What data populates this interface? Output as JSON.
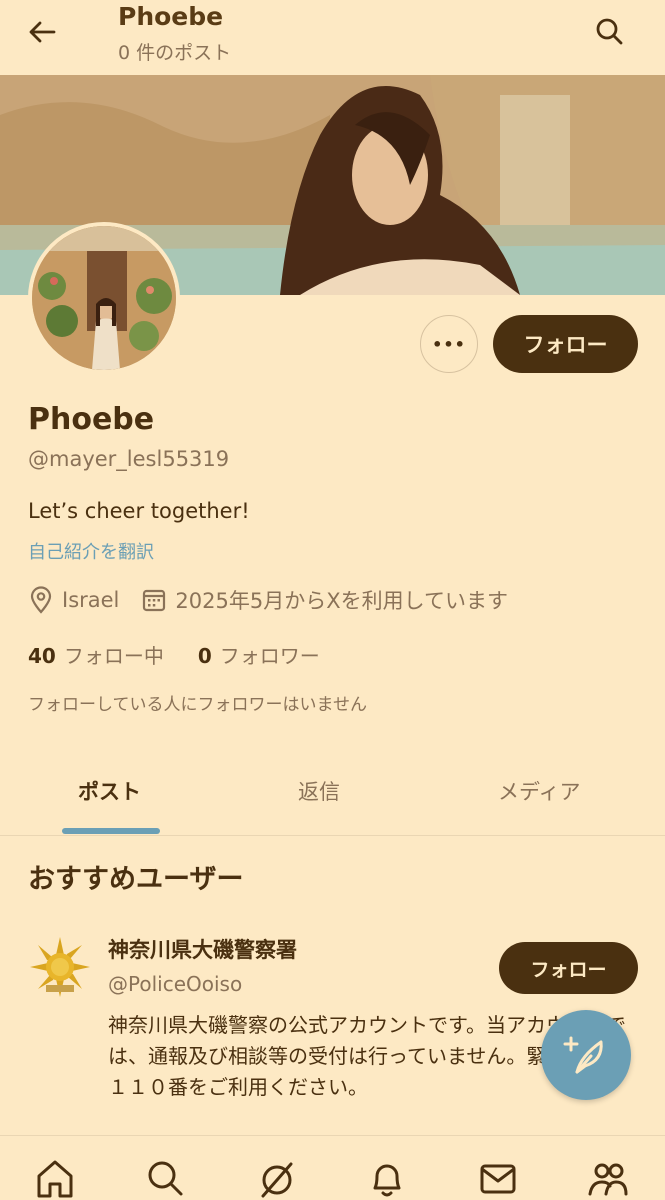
{
  "header": {
    "title": "Phoebe",
    "post_count": "0 件のポスト"
  },
  "profile": {
    "more_label": "•••",
    "follow_label": "フォロー",
    "name": "Phoebe",
    "handle": "@mayer_lesl55319",
    "bio": "Let’s cheer together!",
    "translate_label": "自己紹介を翻訳",
    "location": "Israel",
    "joined": "2025年5月からXを利用しています",
    "following_count": "40",
    "following_label": "フォロー中",
    "followers_count": "0",
    "followers_label": "フォロワー",
    "followers_note": "フォローしている人にフォロワーはいません"
  },
  "tabs": [
    {
      "label": "ポスト",
      "active": true
    },
    {
      "label": "返信",
      "active": false
    },
    {
      "label": "メディア",
      "active": false
    }
  ],
  "recommended": {
    "title": "おすすめユーザー",
    "user": {
      "name": "神奈川県大磯警察署",
      "handle": "@PoliceOoiso",
      "follow_label": "フォロー",
      "bio": "神奈川県大磯警察の公式アカウントです。当アカウントでは、通報及び相談等の受付は行っていません。緊急時は、１１０番をご利用ください。"
    }
  },
  "colors": {
    "background": "#fde9c4",
    "primary_text": "#4a3010",
    "secondary_text": "#8a7258",
    "accent": "#6b9fb5"
  },
  "icons": {
    "back": "arrow-left-icon",
    "search": "search-icon",
    "location": "map-pin-icon",
    "calendar": "calendar-icon",
    "compose": "feather-plus-icon",
    "nav": [
      "home-icon",
      "search-icon",
      "grok-icon",
      "bell-icon",
      "mail-icon",
      "people-icon"
    ]
  }
}
